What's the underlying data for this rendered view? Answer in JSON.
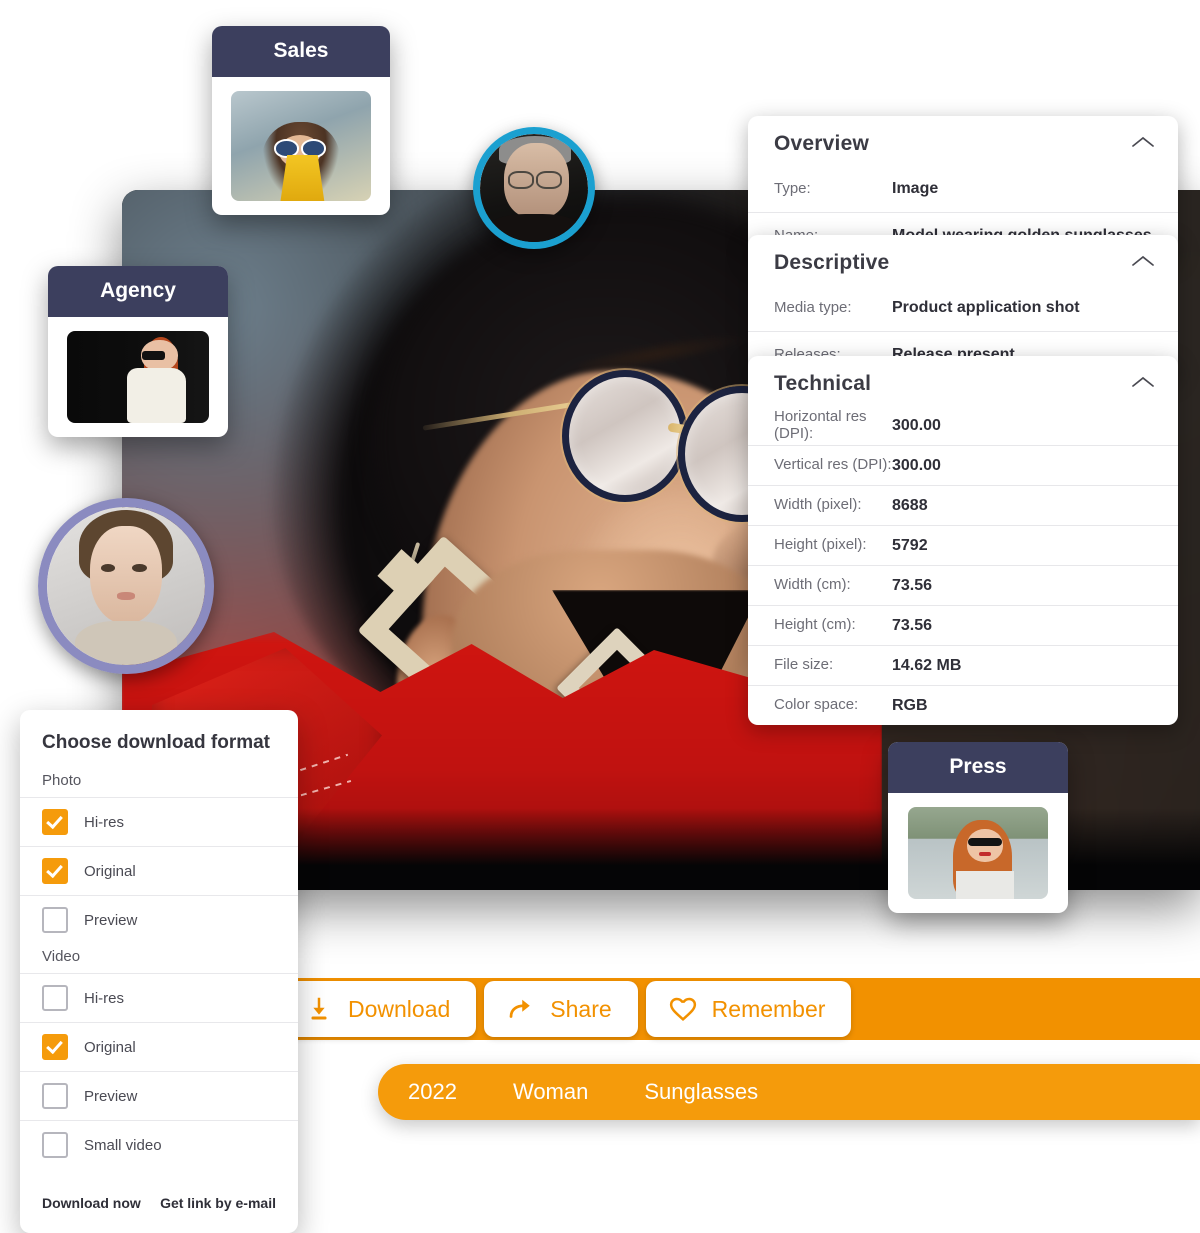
{
  "main_image": {
    "alt": "Model wearing golden sunglasses"
  },
  "meta_panels": [
    {
      "id": "overview",
      "title": "Overview",
      "collapse_icon": "chevron-up-icon",
      "rows": [
        {
          "key": "Type:",
          "value": "Image"
        },
        {
          "key": "Name:",
          "value": "Model wearing golden sunglasses"
        }
      ]
    },
    {
      "id": "descriptive",
      "title": "Descriptive",
      "collapse_icon": "chevron-up-icon",
      "rows": [
        {
          "key": "Media type:",
          "value": "Product application shot"
        },
        {
          "key": "Releases:",
          "value": "Release present"
        }
      ]
    },
    {
      "id": "technical",
      "title": "Technical",
      "collapse_icon": "chevron-up-icon",
      "rows": [
        {
          "key": "Horizontal res (DPI):",
          "value": "300.00"
        },
        {
          "key": "Vertical res (DPI):",
          "value": "300.00"
        },
        {
          "key": "Width (pixel):",
          "value": "8688"
        },
        {
          "key": "Height (pixel):",
          "value": "5792"
        },
        {
          "key": "Width (cm):",
          "value": "73.56"
        },
        {
          "key": "Height (cm):",
          "value": "73.56"
        },
        {
          "key": "File size:",
          "value": "14.62 MB"
        },
        {
          "key": "Color space:",
          "value": "RGB"
        }
      ]
    }
  ],
  "download_dialog": {
    "title": "Choose download format",
    "groups": [
      {
        "label": "Photo",
        "options": [
          {
            "label": "Hi-res",
            "checked": true
          },
          {
            "label": "Original",
            "checked": true
          },
          {
            "label": "Preview",
            "checked": false
          }
        ]
      },
      {
        "label": "Video",
        "options": [
          {
            "label": "Hi-res",
            "checked": false
          },
          {
            "label": "Original",
            "checked": true
          },
          {
            "label": "Preview",
            "checked": false
          },
          {
            "label": "Small video",
            "checked": false
          }
        ]
      }
    ],
    "primary_action": "Download now",
    "secondary_action": "Get link by e-mail"
  },
  "action_bar": {
    "buttons": [
      {
        "label": "Download",
        "icon": "download-icon"
      },
      {
        "label": "Share",
        "icon": "share-arrow-icon"
      },
      {
        "label": "Remember",
        "icon": "heart-icon"
      }
    ],
    "accent_color": "#F29100"
  },
  "tag_bar": {
    "tags": [
      "2022",
      "Woman",
      "Sunglasses"
    ],
    "background_color": "#F59B0B"
  },
  "role_cards": [
    {
      "id": "sales",
      "title": "Sales"
    },
    {
      "id": "agency",
      "title": "Agency"
    },
    {
      "id": "press",
      "title": "Press"
    }
  ],
  "avatars": [
    {
      "id": "man",
      "ring_color": "#1BA0D0"
    },
    {
      "id": "woman",
      "ring_color": "#8B8BC0"
    }
  ],
  "theme": {
    "card_header": "#3C3F5E",
    "accent_orange": "#F29100",
    "tag_orange": "#F59B0B"
  }
}
